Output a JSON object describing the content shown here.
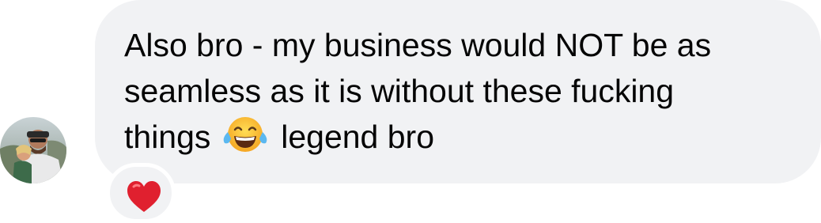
{
  "message": {
    "line1": "Also bro - my business would NOT be as",
    "line2": "seamless as it is without these fucking",
    "line3_before_emoji": "things",
    "line3_after_emoji": "legend bro",
    "inline_emoji": "tears-of-joy-emoji"
  },
  "reaction": {
    "emoji": "red-heart-icon"
  },
  "colors": {
    "bubble_bg": "#f1f2f4",
    "text": "#050505",
    "heart": "#e0202f"
  }
}
